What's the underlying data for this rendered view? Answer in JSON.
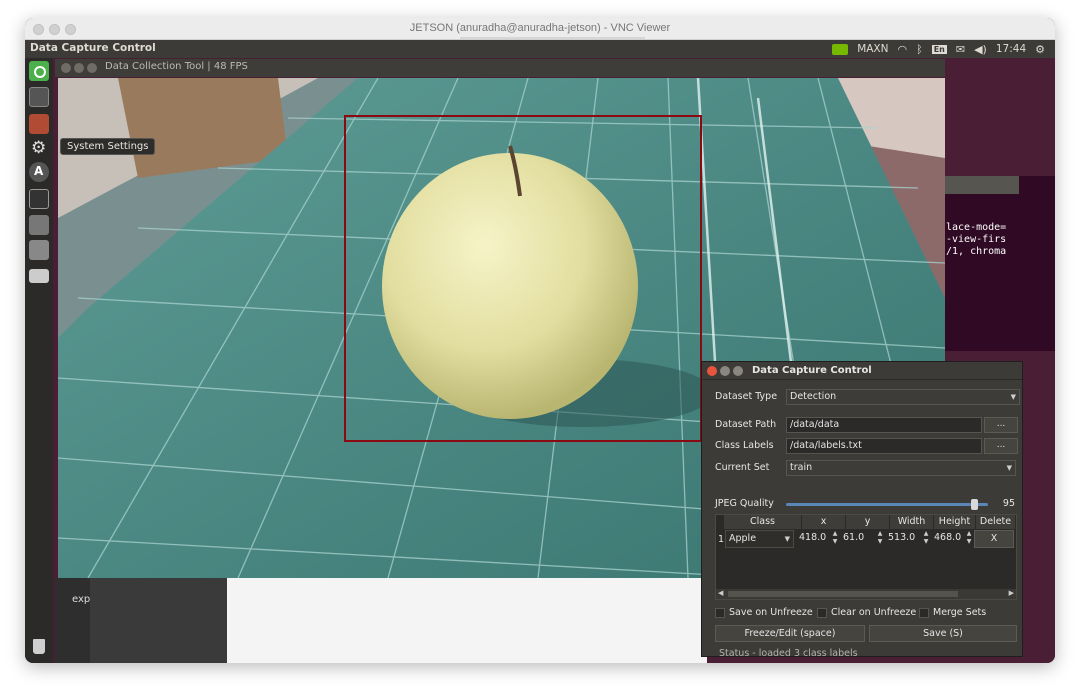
{
  "vnc": {
    "title": "JETSON (anuradha@anuradha-jetson) - VNC Viewer"
  },
  "panel": {
    "app_title": "Data Capture Control",
    "power_mode": "MAXN",
    "lang": "En",
    "time": "17:44",
    "icons": [
      "nvidia-icon",
      "wifi-icon",
      "bluetooth-icon",
      "keyboard-layout-icon",
      "mail-icon",
      "volume-icon",
      "gear-icon"
    ]
  },
  "launcher": {
    "tooltip": "System Settings"
  },
  "terminal": {
    "lines": [
      "lace-mode=",
      "-view-firs",
      "/1, chroma"
    ]
  },
  "desktop": {
    "bottom_text": "exp"
  },
  "video": {
    "title": "Data Collection Tool | 48 FPS",
    "bbox_color": "#8b0a12"
  },
  "dialog": {
    "title": "Data Capture Control",
    "dataset_type_label": "Dataset Type",
    "dataset_type_value": "Detection",
    "dataset_path_label": "Dataset Path",
    "dataset_path_value": "/data/data",
    "class_labels_label": "Class Labels",
    "class_labels_value": "/data/labels.txt",
    "browse_label": "...",
    "current_set_label": "Current Set",
    "current_set_value": "train",
    "jpeg_quality_label": "JPEG Quality",
    "jpeg_quality_value": "95",
    "jpeg_quality_fraction": 0.95,
    "table": {
      "headers": [
        "Class",
        "x",
        "y",
        "Width",
        "Height",
        "Delete"
      ],
      "rows": [
        {
          "index": "1",
          "class": "Apple",
          "x": "418.0",
          "y": "61.0",
          "width": "513.0",
          "height": "468.0",
          "delete": "X"
        }
      ]
    },
    "save_on_unfreeze": "Save on Unfreeze",
    "clear_on_unfreeze": "Clear on Unfreeze",
    "merge_sets": "Merge Sets",
    "freeze_button": "Freeze/Edit (space)",
    "save_button": "Save (S)",
    "status": "Status - loaded 3 class labels"
  }
}
